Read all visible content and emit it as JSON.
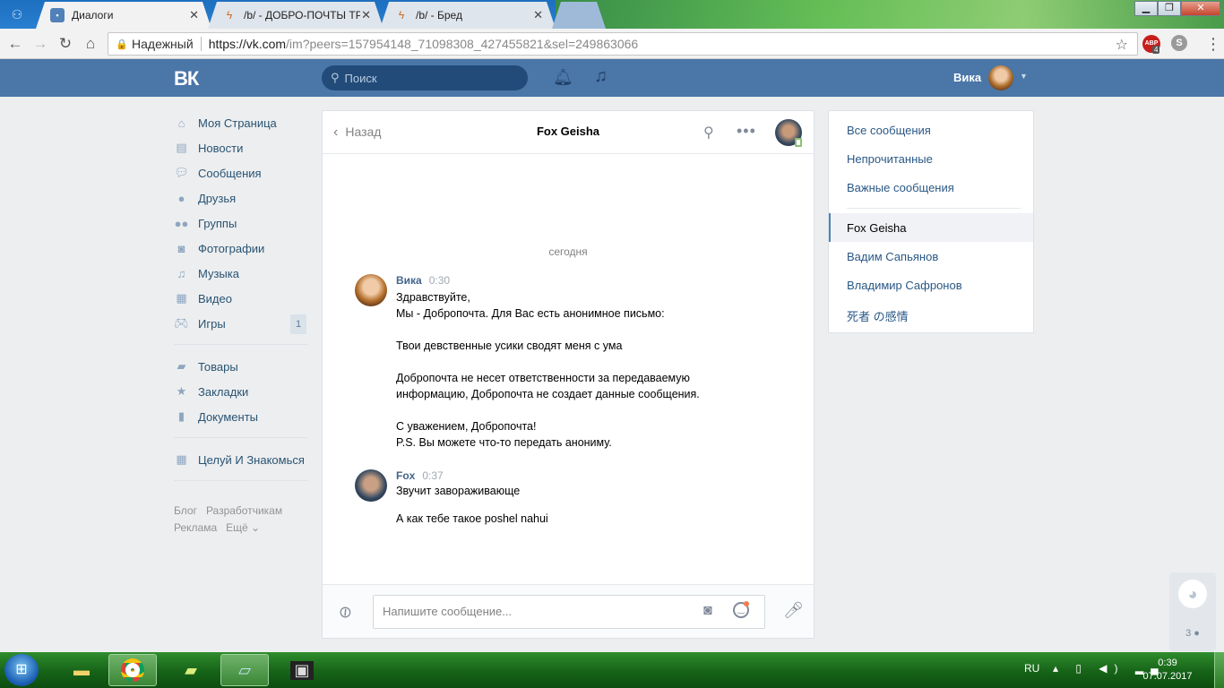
{
  "browser": {
    "tabs": [
      {
        "title": "Диалоги",
        "state": "active"
      },
      {
        "title": "/b/ - ДОБРО-ПОЧТЫ ТР",
        "state": "normal"
      },
      {
        "title": "/b/ - Бред",
        "state": "normal"
      }
    ],
    "secure_label": "Надежный",
    "url_host": "https://vk.com",
    "url_path": "/im?peers=157954148_71098308_427455821&sel=249863066",
    "extension_badge_count": "4",
    "abp_label": "ABP"
  },
  "vk_header": {
    "logo": "ВК",
    "search_placeholder": "Поиск",
    "user_name": "Вика",
    "accent_color": "#4a76a8"
  },
  "left_nav": {
    "items": [
      {
        "label": "Моя Страница",
        "icon": "home-icon"
      },
      {
        "label": "Новости",
        "icon": "news-icon"
      },
      {
        "label": "Сообщения",
        "icon": "messages-icon"
      },
      {
        "label": "Друзья",
        "icon": "friends-icon"
      },
      {
        "label": "Группы",
        "icon": "groups-icon"
      },
      {
        "label": "Фотографии",
        "icon": "camera-icon"
      },
      {
        "label": "Музыка",
        "icon": "music-icon"
      },
      {
        "label": "Видео",
        "icon": "video-icon"
      },
      {
        "label": "Игры",
        "icon": "gamepad-icon",
        "badge": "1"
      }
    ],
    "items2": [
      {
        "label": "Товары",
        "icon": "bag-icon"
      },
      {
        "label": "Закладки",
        "icon": "star-icon"
      },
      {
        "label": "Документы",
        "icon": "document-icon"
      }
    ],
    "items3": [
      {
        "label": "Целуй И Знакомься",
        "icon": "apps-icon"
      }
    ],
    "footer": {
      "blog": "Блог",
      "developers": "Разработчикам",
      "ads": "Реклама",
      "more": "Ещё ⌄"
    }
  },
  "chat": {
    "back_label": "Назад",
    "peer_name": "Fox Geisha",
    "date_divider": "сегодня",
    "messages": [
      {
        "author": "Вика",
        "time": "0:30",
        "text": "Здравствуйте,\nМы - Добропочта. Для Вас есть анонимное письмо:\n\nТвои девственные усики сводят меня с ума\n\nДобропочта не несет ответственности за передаваемую\nинформацию, Добропочта не создает данные сообщения.\n\nС уважением, Добропочта!\nP.S. Вы можете что-то передать анониму."
      },
      {
        "author": "Fox",
        "time": "0:37",
        "text": "Звучит завораживающе\n\nА как тебе такое poshel nahui"
      }
    ],
    "composer_placeholder": "Напишите сообщение..."
  },
  "right_panel": {
    "filters": [
      "Все сообщения",
      "Непрочитанные",
      "Важные сообщения"
    ],
    "conversations": [
      {
        "name": "Fox Geisha",
        "active": true
      },
      {
        "name": "Вадим Сапьянов",
        "active": false
      },
      {
        "name": "Владимир Сафронов",
        "active": false
      },
      {
        "name": "死者 の感情",
        "active": false
      }
    ]
  },
  "side_widget": {
    "count": "3"
  },
  "taskbar": {
    "language": "RU",
    "time": "0:39",
    "date": "07.07.2017"
  }
}
